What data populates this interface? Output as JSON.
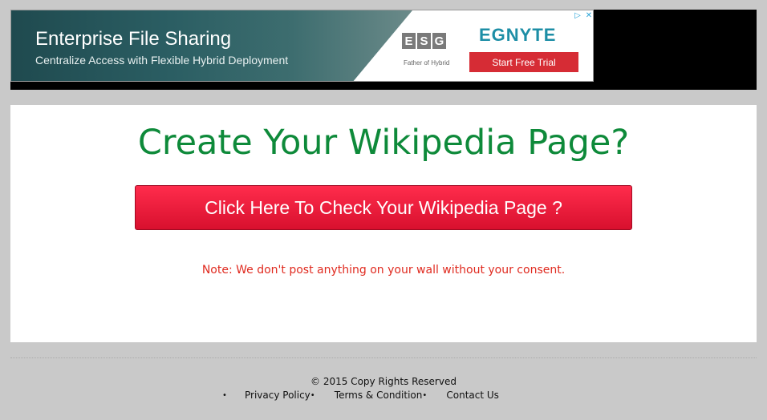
{
  "ad": {
    "title": "Enterprise File Sharing",
    "subtitle": "Centralize Access with Flexible Hybrid Deployment",
    "esg_letters": [
      "E",
      "S",
      "G"
    ],
    "esg_tagline": "Father of Hybrid",
    "brand": "EGNYTE",
    "cta_label": "Start Free Trial",
    "adchoices_icon": "▷",
    "close_icon": "✕"
  },
  "main": {
    "headline": "Create Your Wikipedia Page?",
    "button_label": "Click Here To Check Your Wikipedia Page ?",
    "note": "Note: We don't post anything on your wall without your consent."
  },
  "footer": {
    "copyright": "© 2015 Copy Rights Reserved",
    "bullet": "•",
    "links": [
      "Privacy Policy",
      "Terms & Condition",
      "Contact Us"
    ]
  },
  "colors": {
    "headline": "#0e8a3a",
    "button": "#e8163a",
    "note": "#e02a1f",
    "ad_cta": "#d62c35",
    "brand": "#1d8ea6"
  }
}
